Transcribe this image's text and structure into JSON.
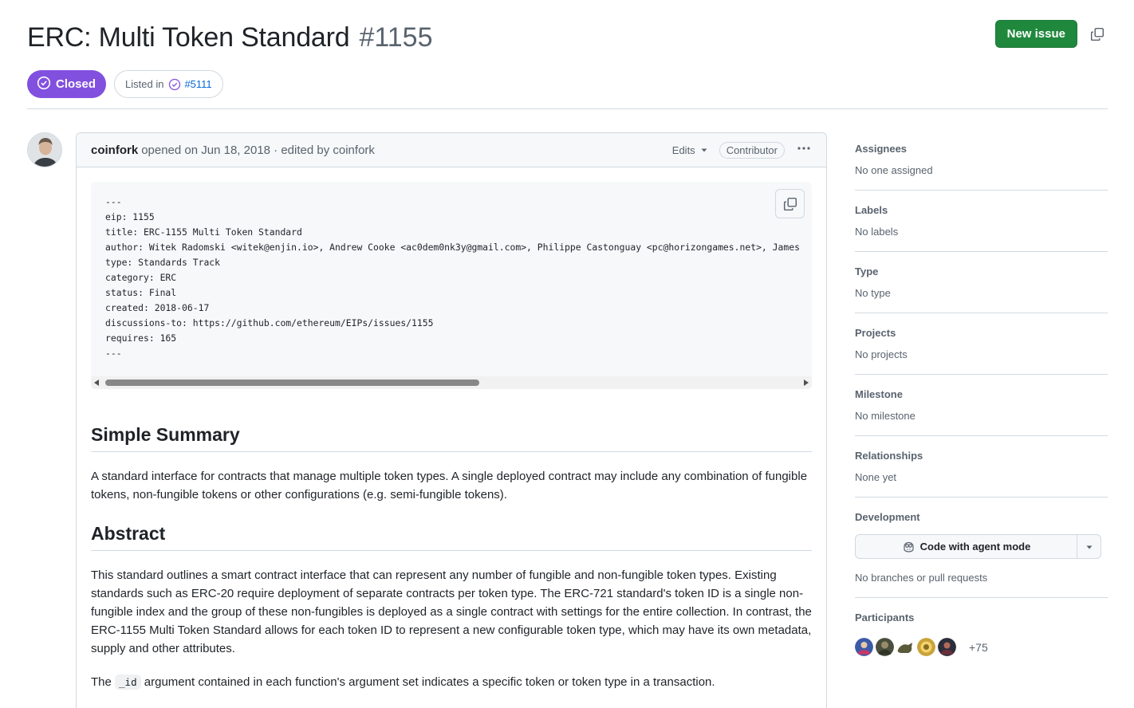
{
  "issue": {
    "title": "ERC: Multi Token Standard",
    "number": "#1155",
    "state": "Closed",
    "listed_in_label": "Listed in",
    "listed_in_ref": "#5111"
  },
  "header": {
    "new_issue_label": "New issue"
  },
  "comment": {
    "author": "coinfork",
    "meta": "opened on Jun 18, 2018 · edited by coinfork",
    "edits_label": "Edits",
    "role_badge": "Contributor",
    "code": "---\neip: 1155\ntitle: ERC-1155 Multi Token Standard\nauthor: Witek Radomski <witek@enjin.io>, Andrew Cooke <ac0dem0nk3y@gmail.com>, Philippe Castonguay <pc@horizongames.net>, James\ntype: Standards Track\ncategory: ERC\nstatus: Final\ncreated: 2018-06-17\ndiscussions-to: https://github.com/ethereum/EIPs/issues/1155\nrequires: 165\n---",
    "h_summary": "Simple Summary",
    "p_summary": "A standard interface for contracts that manage multiple token types. A single deployed contract may include any combination of fungible tokens, non-fungible tokens or other configurations (e.g. semi-fungible tokens).",
    "h_abstract": "Abstract",
    "p_abstract": "This standard outlines a smart contract interface that can represent any number of fungible and non-fungible token types. Existing standards such as ERC-20 require deployment of separate contracts per token type. The ERC-721 standard's token ID is a single non-fungible index and the group of these non-fungibles is deployed as a single contract with settings for the entire collection. In contrast, the ERC-1155 Multi Token Standard allows for each token ID to represent a new configurable token type, which may have its own metadata, supply and other attributes.",
    "p_id_before": "The",
    "p_id_code": "_id",
    "p_id_after": "argument contained in each function's argument set indicates a specific token or token type in a transaction."
  },
  "sidebar": {
    "assignees_title": "Assignees",
    "assignees_value": "No one assigned",
    "labels_title": "Labels",
    "labels_value": "No labels",
    "type_title": "Type",
    "type_value": "No type",
    "projects_title": "Projects",
    "projects_value": "No projects",
    "milestone_title": "Milestone",
    "milestone_value": "No milestone",
    "relationships_title": "Relationships",
    "relationships_value": "None yet",
    "development_title": "Development",
    "agent_button": "Code with agent mode",
    "development_value": "No branches or pull requests",
    "participants_title": "Participants",
    "participants_more": "+75"
  },
  "colors": {
    "primary_green": "#1f883d",
    "closed_purple": "#8250df",
    "link_blue": "#0969da",
    "muted": "#59636e",
    "border": "#d1d9e0"
  },
  "icons": {
    "copy_header": "copy-icon",
    "closed_state": "check-circle-icon",
    "listed_in": "issue-closed-icon",
    "caret": "triangle-down-icon",
    "kebab": "kebab-horizontal-icon",
    "copy_code": "copy-icon",
    "agent": "copilot-icon"
  }
}
